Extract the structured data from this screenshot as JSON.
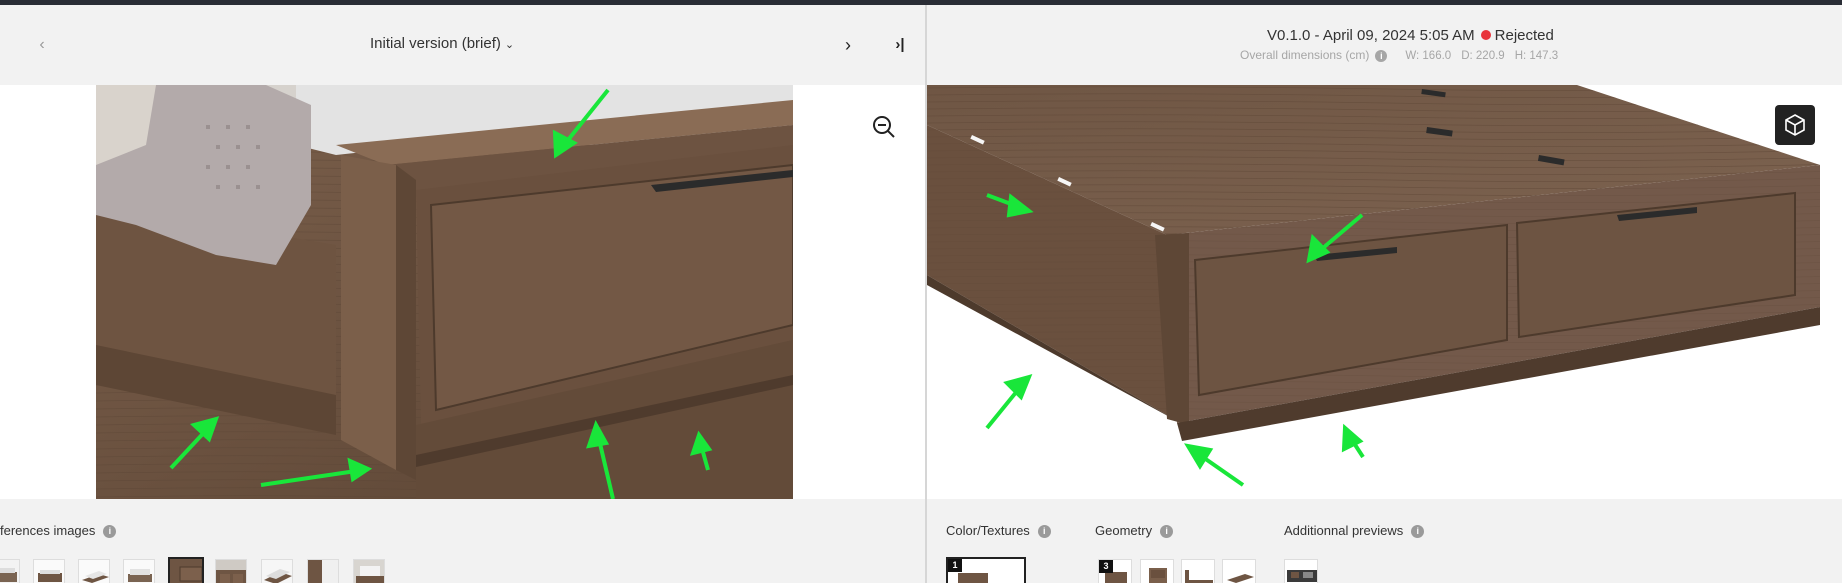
{
  "left": {
    "version_select": "Initial version (brief)",
    "prev_icon": "chevron-left-icon",
    "next_icon": "chevron-right-icon",
    "last_icon": "skip-to-last-icon",
    "reference_label": "ferences images",
    "info_icon": "info-icon"
  },
  "right": {
    "version": "V0.1.0 - April 09, 2024 5:05 AM",
    "status": "Rejected",
    "status_color": "#e8333a",
    "dims_label": "Overall dimensions (cm)",
    "width": "W: 166.0",
    "depth": "D: 220.9",
    "height": "H: 147.3",
    "color_textures_label": "Color/Textures",
    "geometry_label": "Geometry",
    "additional_previews_label": "Additionnal previews",
    "color_badge": "1",
    "geometry_badge": "3"
  },
  "colors": {
    "annotation_arrow": "#19e63a",
    "wood": "#6e5543",
    "dark_button": "#222222"
  }
}
